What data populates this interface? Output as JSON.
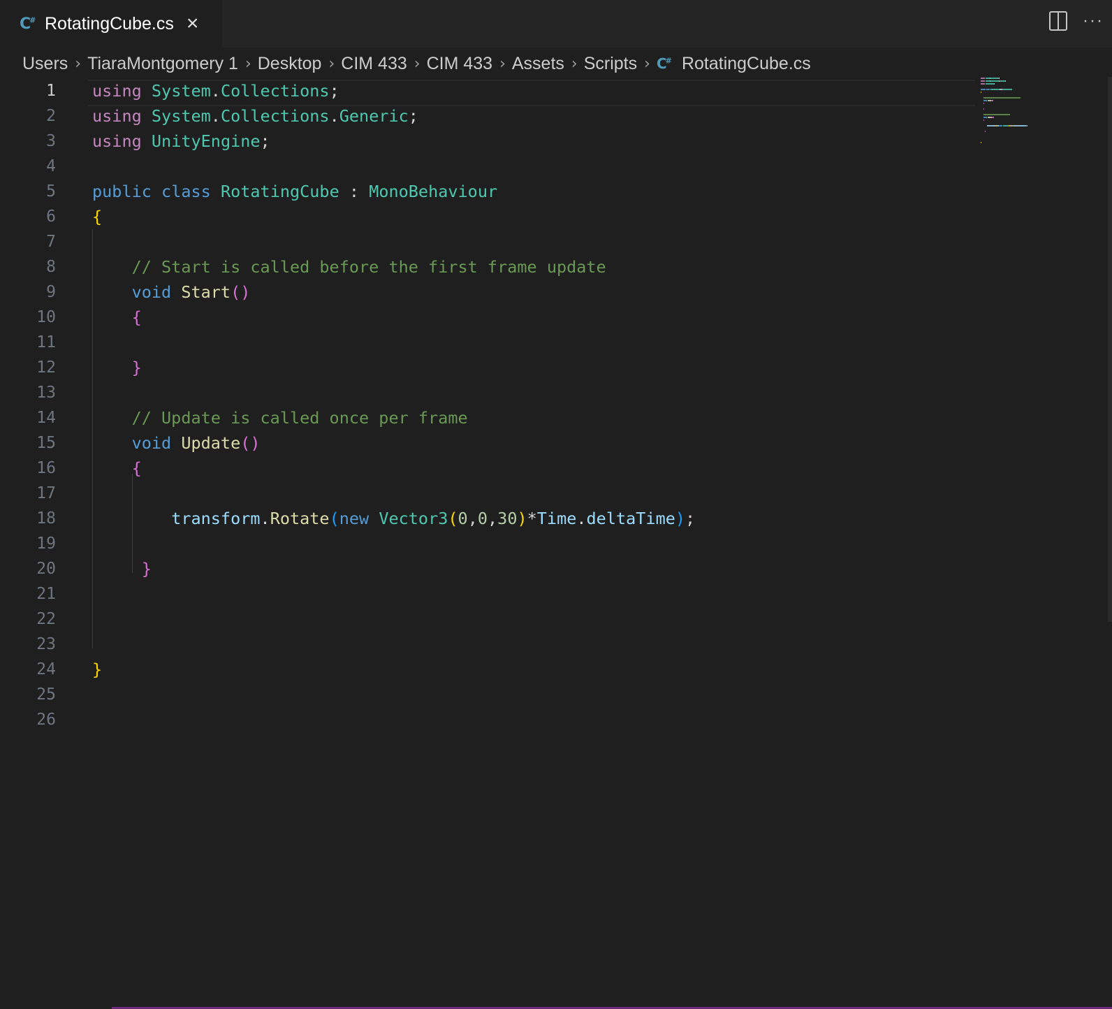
{
  "tab": {
    "label": "RotatingCube.cs",
    "icon": "csharp-file-icon"
  },
  "breadcrumb": [
    "Users",
    "TiaraMontgomery 1",
    "Desktop",
    "CIM 433",
    "CIM 433",
    "Assets",
    "Scripts",
    "RotatingCube.cs"
  ],
  "editor": {
    "active_line": 1,
    "line_numbers": [
      "1",
      "2",
      "3",
      "4",
      "5",
      "6",
      "7",
      "8",
      "9",
      "10",
      "11",
      "12",
      "13",
      "14",
      "15",
      "16",
      "17",
      "18",
      "19",
      "20",
      "21",
      "22",
      "23",
      "24",
      "25",
      "26"
    ],
    "lines": [
      [
        [
          "kw-ctrl",
          "using"
        ],
        [
          "",
          " "
        ],
        [
          "type",
          "System"
        ],
        [
          "",
          "."
        ],
        [
          "type",
          "Collections"
        ],
        [
          "",
          ";"
        ]
      ],
      [
        [
          "kw-ctrl",
          "using"
        ],
        [
          "",
          " "
        ],
        [
          "type",
          "System"
        ],
        [
          "",
          "."
        ],
        [
          "type",
          "Collections"
        ],
        [
          "",
          "."
        ],
        [
          "type",
          "Generic"
        ],
        [
          "",
          ";"
        ]
      ],
      [
        [
          "kw-ctrl",
          "using"
        ],
        [
          "",
          " "
        ],
        [
          "type",
          "UnityEngine"
        ],
        [
          "",
          ";"
        ]
      ],
      [],
      [
        [
          "kw",
          "public"
        ],
        [
          "",
          " "
        ],
        [
          "kw",
          "class"
        ],
        [
          "",
          " "
        ],
        [
          "type",
          "RotatingCube"
        ],
        [
          "",
          " : "
        ],
        [
          "type",
          "MonoBehaviour"
        ]
      ],
      [
        [
          "b1",
          "{"
        ]
      ],
      [],
      [
        [
          "",
          "    "
        ],
        [
          "cm",
          "// Start is called before the first frame update"
        ]
      ],
      [
        [
          "",
          "    "
        ],
        [
          "kw",
          "void"
        ],
        [
          "",
          " "
        ],
        [
          "fn",
          "Start"
        ],
        [
          "b2",
          "()"
        ]
      ],
      [
        [
          "",
          "    "
        ],
        [
          "b2",
          "{"
        ]
      ],
      [],
      [
        [
          "",
          "    "
        ],
        [
          "b2",
          "}"
        ]
      ],
      [],
      [
        [
          "",
          "    "
        ],
        [
          "cm",
          "// Update is called once per frame"
        ]
      ],
      [
        [
          "",
          "    "
        ],
        [
          "kw",
          "void"
        ],
        [
          "",
          " "
        ],
        [
          "fn",
          "Update"
        ],
        [
          "b2",
          "()"
        ]
      ],
      [
        [
          "",
          "    "
        ],
        [
          "b2",
          "{"
        ]
      ],
      [],
      [
        [
          "",
          "        "
        ],
        [
          "var",
          "transform"
        ],
        [
          "",
          "."
        ],
        [
          "fn",
          "Rotate"
        ],
        [
          "b3",
          "("
        ],
        [
          "kw",
          "new"
        ],
        [
          "",
          " "
        ],
        [
          "type",
          "Vector3"
        ],
        [
          "b1",
          "("
        ],
        [
          "num",
          "0"
        ],
        [
          "",
          ","
        ],
        [
          "num",
          "0"
        ],
        [
          "",
          ","
        ],
        [
          "num",
          "30"
        ],
        [
          "b1",
          ")"
        ],
        [
          "",
          "*"
        ],
        [
          "var",
          "Time"
        ],
        [
          "",
          "."
        ],
        [
          "var",
          "deltaTime"
        ],
        [
          "b3",
          ")"
        ],
        [
          "",
          ";"
        ]
      ],
      [],
      [
        [
          "",
          "     "
        ],
        [
          "b2",
          "}"
        ]
      ],
      [],
      [],
      [],
      [
        [
          "b1",
          "}"
        ]
      ],
      [],
      []
    ]
  },
  "colors": {
    "background": "#1f1f1f",
    "keyword_control": "#c586c0",
    "keyword": "#569cd6",
    "type": "#4ec9b0",
    "function": "#dcdcaa",
    "variable": "#9cdcfe",
    "number": "#b5cea8",
    "comment": "#6a9955"
  }
}
